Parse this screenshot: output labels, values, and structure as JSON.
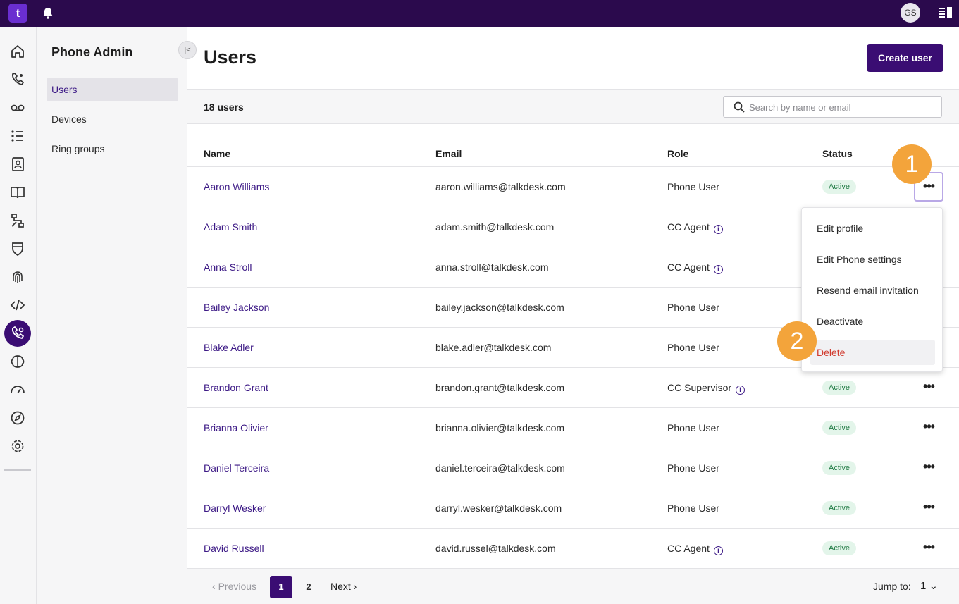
{
  "topbar": {
    "logo": "t",
    "avatar_initials": "GS"
  },
  "rail": {
    "icons": [
      "home-icon",
      "phone-sparkle-icon",
      "voicemail-icon",
      "list-numbered-icon",
      "contacts-icon",
      "book-icon",
      "flow-icon",
      "shield-icon",
      "fingerprint-icon",
      "code-icon",
      "phone-admin-icon",
      "brain-icon",
      "gauge-icon",
      "compass-icon",
      "gear-icon"
    ],
    "active": "phone-admin-icon"
  },
  "sidenav": {
    "title": "Phone Admin",
    "items": [
      {
        "label": "Users",
        "active": true
      },
      {
        "label": "Devices",
        "active": false
      },
      {
        "label": "Ring groups",
        "active": false
      }
    ]
  },
  "header": {
    "title": "Users",
    "create_label": "Create user"
  },
  "subbar": {
    "count": "18 users",
    "search_placeholder": "Search by name or email"
  },
  "table": {
    "columns": [
      "Name",
      "Email",
      "Role",
      "Status"
    ],
    "rows": [
      {
        "name": "Aaron Williams",
        "email": "aaron.williams@talkdesk.com",
        "role": "Phone User",
        "info": false,
        "status": "Active"
      },
      {
        "name": "Adam Smith",
        "email": "adam.smith@talkdesk.com",
        "role": "CC Agent",
        "info": true,
        "status": ""
      },
      {
        "name": "Anna Stroll",
        "email": "anna.stroll@talkdesk.com",
        "role": "CC Agent",
        "info": true,
        "status": ""
      },
      {
        "name": "Bailey Jackson",
        "email": "bailey.jackson@talkdesk.com",
        "role": "Phone User",
        "info": false,
        "status": ""
      },
      {
        "name": "Blake Adler",
        "email": "blake.adler@talkdesk.com",
        "role": "Phone User",
        "info": false,
        "status": ""
      },
      {
        "name": "Brandon Grant",
        "email": "brandon.grant@talkdesk.com",
        "role": "CC Supervisor",
        "info": true,
        "status": "Active"
      },
      {
        "name": "Brianna Olivier",
        "email": "brianna.olivier@talkdesk.com",
        "role": "Phone User",
        "info": false,
        "status": "Active"
      },
      {
        "name": "Daniel Terceira",
        "email": "daniel.terceira@talkdesk.com",
        "role": "Phone User",
        "info": false,
        "status": "Active"
      },
      {
        "name": "Darryl Wesker",
        "email": "darryl.wesker@talkdesk.com",
        "role": "Phone User",
        "info": false,
        "status": "Active"
      },
      {
        "name": "David Russell",
        "email": "david.russel@talkdesk.com",
        "role": "CC Agent",
        "info": true,
        "status": "Active"
      }
    ]
  },
  "menu": {
    "items": [
      "Edit profile",
      "Edit Phone settings",
      "Resend email invitation",
      "Deactivate",
      "Delete"
    ]
  },
  "callouts": [
    "1",
    "2"
  ],
  "pagination": {
    "prev": "Previous",
    "pages": [
      "1",
      "2"
    ],
    "current": "1",
    "next": "Next",
    "jump_label": "Jump to:",
    "jump_value": "1"
  },
  "colors": {
    "brand": "#3a0d73",
    "topbar": "#2b0a4d",
    "callout": "#f3a43b",
    "danger": "#d13b2f",
    "active_badge_bg": "#e3f5ea"
  }
}
